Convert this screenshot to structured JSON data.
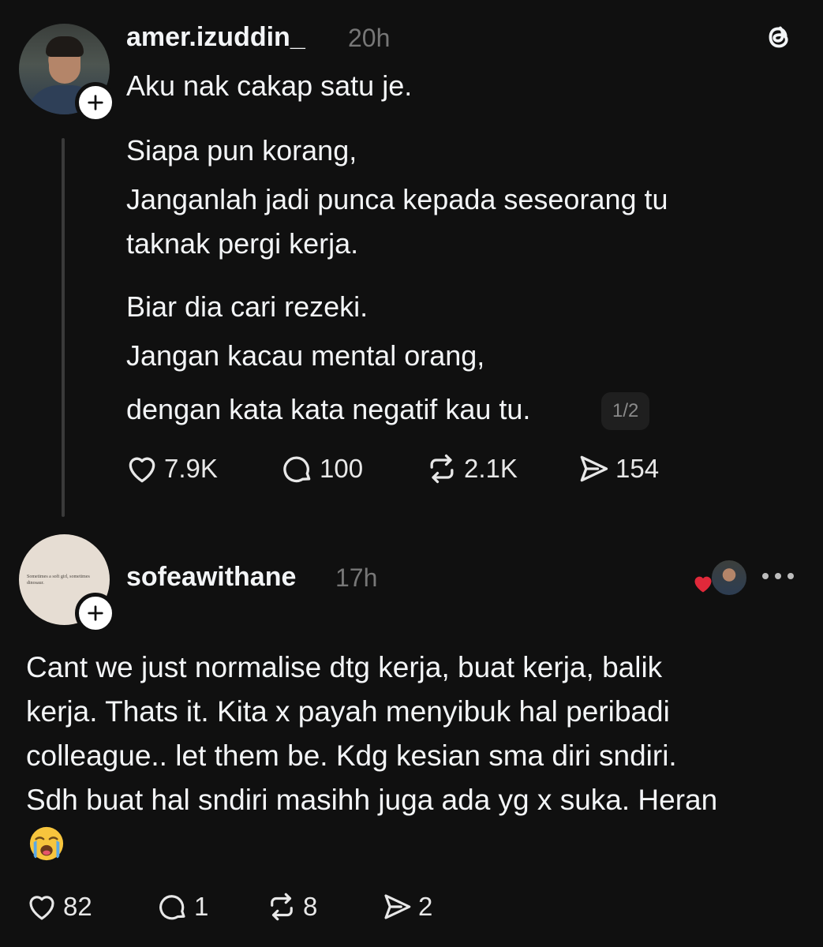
{
  "post": {
    "username": "amer.izuddin_",
    "time": "20h",
    "lines": [
      "Aku nak cakap satu je.",
      "Siapa pun korang,",
      "Janganlah jadi punca kepada seseorang tu",
      "taknak pergi kerja.",
      "Biar dia cari rezeki.",
      "Jangan kacau mental orang,",
      "dengan kata kata negatif kau tu."
    ],
    "page_indicator": "1/2",
    "likes": "7.9K",
    "comments": "100",
    "reposts": "2.1K",
    "shares": "154"
  },
  "reply": {
    "username": "sofeawithane",
    "time": "17h",
    "avatar_text": "Sometimes a soft girl, sometimes dinosaur.",
    "lines": [
      "Cant we just normalise dtg kerja, buat kerja, balik",
      "kerja. Thats it. Kita x payah menyibuk hal peribadi",
      "colleague.. let them be. Kdg kesian sma diri sndiri.",
      "Sdh buat hal sndiri masihh juga ada yg x suka. Heran"
    ],
    "emoji": "loudly-crying-face",
    "likes": "82",
    "comments": "1",
    "reposts": "8",
    "shares": "2"
  },
  "icons": {
    "like": "heart-icon",
    "comment": "comment-bubble-icon",
    "repost": "repost-icon",
    "share": "send-icon",
    "follow": "plus-icon",
    "logo": "threads-logo-icon",
    "more": "more-dots-icon"
  },
  "colors": {
    "background": "#101010",
    "text": "#f3f5f7",
    "muted": "#777777",
    "liked_heart": "#e0293a"
  }
}
